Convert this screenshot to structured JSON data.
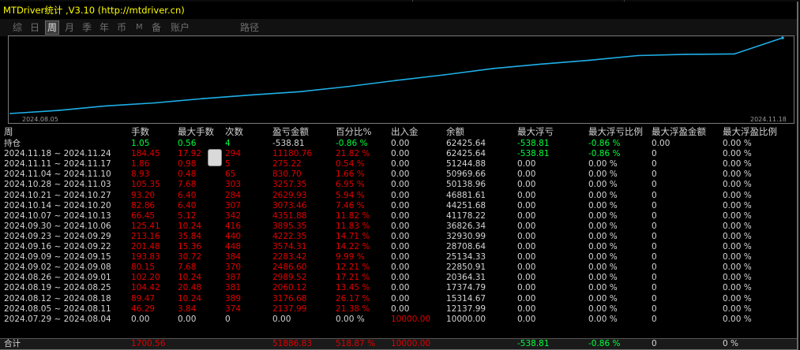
{
  "window": {
    "title": "MTDriver统计 ,V3.10 (http://mtdriver.cn)"
  },
  "tabs": [
    {
      "label": "综",
      "active": false
    },
    {
      "label": "日",
      "active": false
    },
    {
      "label": "周",
      "active": true
    },
    {
      "label": "月",
      "active": false
    },
    {
      "label": "季",
      "active": false
    },
    {
      "label": "年",
      "active": false
    },
    {
      "label": "币",
      "active": false
    },
    {
      "label": "M",
      "active": false
    },
    {
      "label": "备",
      "active": false
    },
    {
      "label": "账户",
      "active": false
    },
    {
      "label": "路径",
      "active": false
    }
  ],
  "chart_data": {
    "type": "line",
    "title": "",
    "x_tick_labels": [
      "2024.08.05",
      "2024.11.18"
    ],
    "series": [
      {
        "color": "#1fb0e8",
        "values": [
          10000.0,
          12137.99,
          15314.67,
          17374.79,
          20364.31,
          22850.91,
          25134.33,
          28708.64,
          32930.99,
          36826.34,
          41178.22,
          44251.68,
          46881.61,
          50138.96,
          50969.66,
          51244.88,
          62425.64
        ]
      }
    ],
    "grid": false
  },
  "table": {
    "headers": [
      "周",
      "手数",
      "最大手数",
      "次数",
      "盈亏金额",
      "百分比%",
      "出入金",
      "余额",
      "最大浮亏",
      "最大浮亏比例",
      "最大浮盈金额",
      "最大浮盈比例"
    ],
    "holding": [
      "持仓",
      "1.05",
      "0.56",
      "4",
      "-538.81",
      "-0.86 %",
      "0.00",
      "62425.64",
      "-538.81",
      "-0.86 %",
      "0.00",
      "0.00 %"
    ],
    "rows": [
      [
        "2024.11.18 ~ 2024.11.24",
        "184.45",
        "17.92",
        "294",
        "11180.76",
        "21.82 %",
        "0.00",
        "62425.64",
        "-538.81",
        "-0.86 %",
        "0",
        "0.00 %"
      ],
      [
        "2024.11.11 ~ 2024.11.17",
        "1.86",
        "0.98",
        "5",
        "275.22",
        "0.54 %",
        "0.00",
        "51244.88",
        "0.00",
        "0.00 %",
        "0",
        "0.00 %"
      ],
      [
        "2024.11.04 ~ 2024.11.10",
        "8.93",
        "0.48",
        "65",
        "830.70",
        "1.66 %",
        "0.00",
        "50969.66",
        "0.00",
        "0.00 %",
        "0",
        "0.00 %"
      ],
      [
        "2024.10.28 ~ 2024.11.03",
        "105.35",
        "7.68",
        "303",
        "3257.35",
        "6.95 %",
        "0.00",
        "50138.96",
        "0.00",
        "0.00 %",
        "0",
        "0.00 %"
      ],
      [
        "2024.10.21 ~ 2024.10.27",
        "93.20",
        "6.40",
        "284",
        "2629.93",
        "5.94 %",
        "0.00",
        "46881.61",
        "0.00",
        "0.00 %",
        "0",
        "0.00 %"
      ],
      [
        "2024.10.14 ~ 2024.10.20",
        "82.86",
        "6.40",
        "307",
        "3073.46",
        "7.46 %",
        "0.00",
        "44251.68",
        "0.00",
        "0.00 %",
        "0",
        "0.00 %"
      ],
      [
        "2024.10.07 ~ 2024.10.13",
        "66.45",
        "5.12",
        "342",
        "4351.88",
        "11.82 %",
        "0.00",
        "41178.22",
        "0.00",
        "0.00 %",
        "0",
        "0.00 %"
      ],
      [
        "2024.09.30 ~ 2024.10.06",
        "125.41",
        "10.24",
        "416",
        "3895.35",
        "11.83 %",
        "0.00",
        "36826.34",
        "0.00",
        "0.00 %",
        "0",
        "0.00 %"
      ],
      [
        "2024.09.23 ~ 2024.09.29",
        "213.16",
        "35.84",
        "440",
        "4222.35",
        "14.71 %",
        "0.00",
        "32930.99",
        "0.00",
        "0.00 %",
        "0",
        "0.00 %"
      ],
      [
        "2024.09.16 ~ 2024.09.22",
        "201.48",
        "15.36",
        "448",
        "3574.31",
        "14.22 %",
        "0.00",
        "28708.64",
        "0.00",
        "0.00 %",
        "0",
        "0.00 %"
      ],
      [
        "2024.09.09 ~ 2024.09.15",
        "193.83",
        "30.72",
        "384",
        "2283.42",
        "9.99 %",
        "0.00",
        "25134.33",
        "0.00",
        "0.00 %",
        "0",
        "0.00 %"
      ],
      [
        "2024.09.02 ~ 2024.09.08",
        "80.15",
        "7.68",
        "370",
        "2486.60",
        "12.21 %",
        "0.00",
        "22850.91",
        "0.00",
        "0.00 %",
        "0",
        "0.00 %"
      ],
      [
        "2024.08.26 ~ 2024.09.01",
        "102.20",
        "10.24",
        "387",
        "2989.52",
        "17.21 %",
        "0.00",
        "20364.31",
        "0.00",
        "0.00 %",
        "0",
        "0.00 %"
      ],
      [
        "2024.08.19 ~ 2024.08.25",
        "104.42",
        "20.48",
        "381",
        "2060.12",
        "13.45 %",
        "0.00",
        "17374.79",
        "0.00",
        "0.00 %",
        "0",
        "0.00 %"
      ],
      [
        "2024.08.12 ~ 2024.08.18",
        "89.47",
        "10.24",
        "389",
        "3176.68",
        "26.17 %",
        "0.00",
        "15314.67",
        "0.00",
        "0.00 %",
        "0",
        "0.00 %"
      ],
      [
        "2024.08.05 ~ 2024.08.11",
        "46.29",
        "3.84",
        "374",
        "2137.99",
        "21.38 %",
        "0.00",
        "12137.99",
        "0.00",
        "0.00 %",
        "0",
        "0.00 %"
      ],
      [
        "2024.07.29 ~ 2024.08.04",
        "0.00",
        "0.00",
        "0",
        "0.00",
        "0.00 %",
        "10000.00",
        "10000.00",
        "0.00",
        "0.00 %",
        "0",
        "0.00 %"
      ]
    ],
    "total": [
      "合计",
      "1700.56",
      "",
      "",
      "51886.83",
      "518.87 %",
      "10000.00",
      "",
      "-538.81",
      "-0.86 %",
      "0",
      "0 %"
    ]
  },
  "colors": {
    "accent_line": "#1fb0e8",
    "loss_text": "#e00000",
    "gain_text": "#00ff3c",
    "title_text": "#ffff00"
  }
}
